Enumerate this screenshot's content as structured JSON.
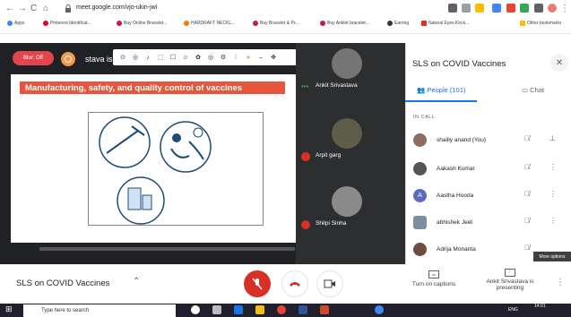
{
  "browser": {
    "url": "meet.google.com/vjo-ukin-jwi",
    "bookmarks": [
      "Apps",
      "Pinterest Identifcat...",
      "Buy Online Bracelet...",
      "HARDRAFT NECKL...",
      "Buy Bracelet & Pr...",
      "Buy Anklet bracelet...",
      "Earring",
      "Natural Eyes Kirck...",
      "Other bookmarks"
    ]
  },
  "meet": {
    "blur_label": "Blur: Off",
    "presenter_banner": "stava is",
    "slide_title": "Manufacturing, safety, and quality control of vaccines",
    "meeting_name": "SLS on COVID Vaccines",
    "captions_label": "Turn on captions",
    "presenting_label": "Ankit Srivastava is presenting",
    "toolbar_icons": [
      "⊙",
      "◎",
      "♪",
      "⬚",
      "☐",
      "☺",
      "✿",
      "◎",
      "⚙",
      "⁞",
      "»",
      "–",
      "✥"
    ]
  },
  "tiles": [
    {
      "name": "Ankit Srivastava",
      "muted": false
    },
    {
      "name": "Arpit garg",
      "muted": true
    },
    {
      "name": "Shilpi Sinha",
      "muted": true
    }
  ],
  "panel": {
    "title": "SLS on COVID Vaccines",
    "people_tab": "People (101)",
    "chat_tab": "Chat",
    "in_call_label": "IN CALL",
    "people": [
      {
        "name": "shailly anand (You)",
        "color": "#8d6e63"
      },
      {
        "name": "Aakash Kumar",
        "color": "#555555"
      },
      {
        "name": "Aastha Hooda",
        "color": "#5c6bc0",
        "initial": "A"
      },
      {
        "name": "abhishek Jeet",
        "color": "#7b8fa1"
      },
      {
        "name": "Adrija Monanta",
        "color": "#6d4c41"
      }
    ],
    "tooltip": "More options"
  },
  "taskbar": {
    "search_placeholder": "Type here to search",
    "time": "14:01",
    "lang": "ENG"
  }
}
